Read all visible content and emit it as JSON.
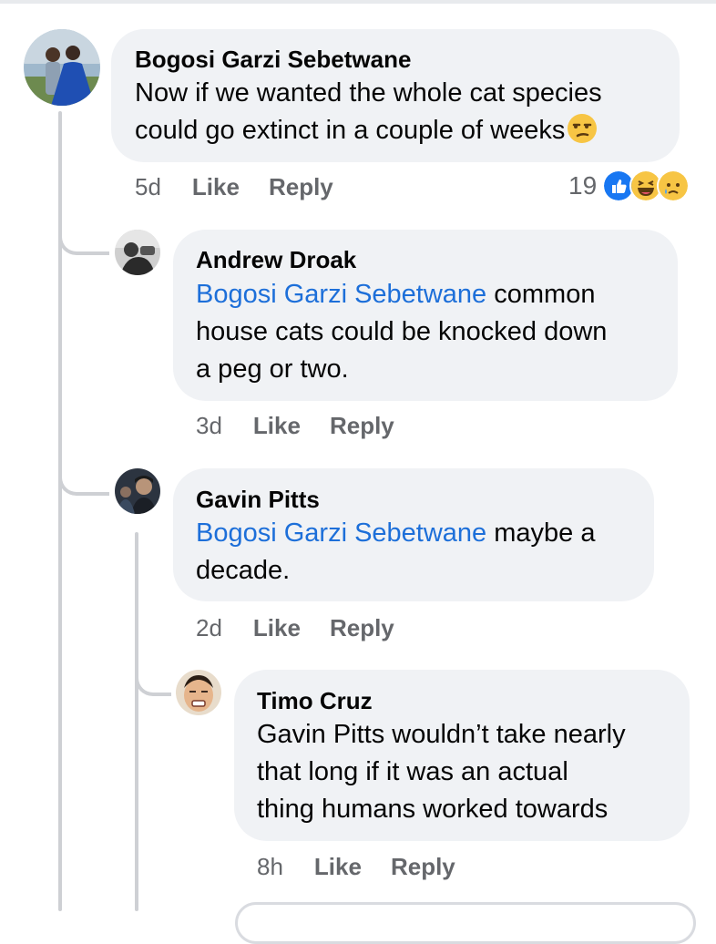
{
  "comments": [
    {
      "author": "Bogosi Garzi Sebetwane",
      "text_lines": [
        "Now if we wanted the whole cat species",
        "could go extinct in a couple of weeks"
      ],
      "emoji": "unamused-face",
      "time": "5d",
      "like_label": "Like",
      "reply_label": "Reply",
      "reaction_count": "19",
      "reactions": [
        "like",
        "haha",
        "sad"
      ]
    },
    {
      "author": "Andrew Droak",
      "mention": "Bogosi Garzi Sebetwane",
      "text_line1_rest": " common",
      "text_line2": "house cats could be knocked down",
      "text_line3": "a peg or two.",
      "time": "3d",
      "like_label": "Like",
      "reply_label": "Reply"
    },
    {
      "author": "Gavin Pitts",
      "mention": "Bogosi Garzi Sebetwane",
      "text_line1_rest": " maybe a",
      "text_line2": "decade.",
      "time": "2d",
      "like_label": "Like",
      "reply_label": "Reply"
    },
    {
      "author": "Timo Cruz",
      "text_lines": [
        "Gavin Pitts wouldn’t take nearly",
        "that long if it was an actual",
        "thing humans worked towards"
      ],
      "time": "8h",
      "like_label": "Like",
      "reply_label": "Reply"
    }
  ],
  "colors": {
    "mention": "#1d6fd9",
    "bubble": "#f0f2f5",
    "meta": "#65676b",
    "thread": "#ced0d4"
  }
}
